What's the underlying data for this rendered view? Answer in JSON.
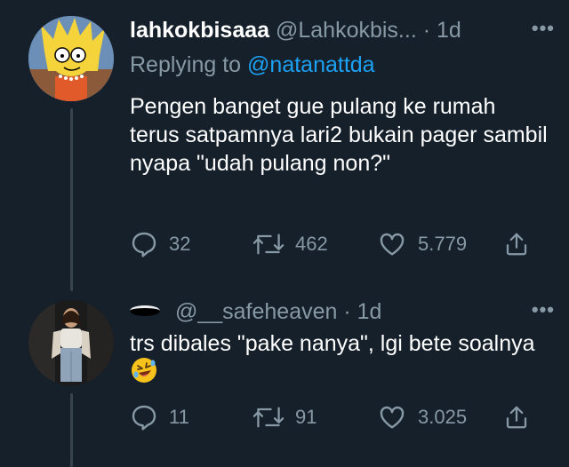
{
  "tweets": [
    {
      "display_name": "lahkokbisaaa",
      "handle": "@Lahkokbis...",
      "separator": "·",
      "time": "1d",
      "replying_prefix": "Replying to",
      "replying_mention": "@natanattda",
      "text": "Pengen banget gue pulang ke rumah terus satpamnya lari2 bukain pager sambil nyapa \"udah pulang non?\"",
      "reply_count": "32",
      "retweet_count": "462",
      "like_count": "5.779",
      "more_label": "•••"
    },
    {
      "handle": "@__safeheaven",
      "separator": "·",
      "time": "1d",
      "text": "trs dibales \"pake nanya\", lgi bete soalnya",
      "reply_count": "11",
      "retweet_count": "91",
      "like_count": "3.025",
      "more_label": "•••"
    }
  ],
  "icons": {
    "reply": "reply-icon",
    "retweet": "retweet-icon",
    "like": "heart-icon",
    "share": "share-icon",
    "more": "more-icon"
  },
  "colors": {
    "background": "#15202b",
    "muted": "#8899a6",
    "link": "#1da1f2",
    "thread_line": "#38444d"
  }
}
